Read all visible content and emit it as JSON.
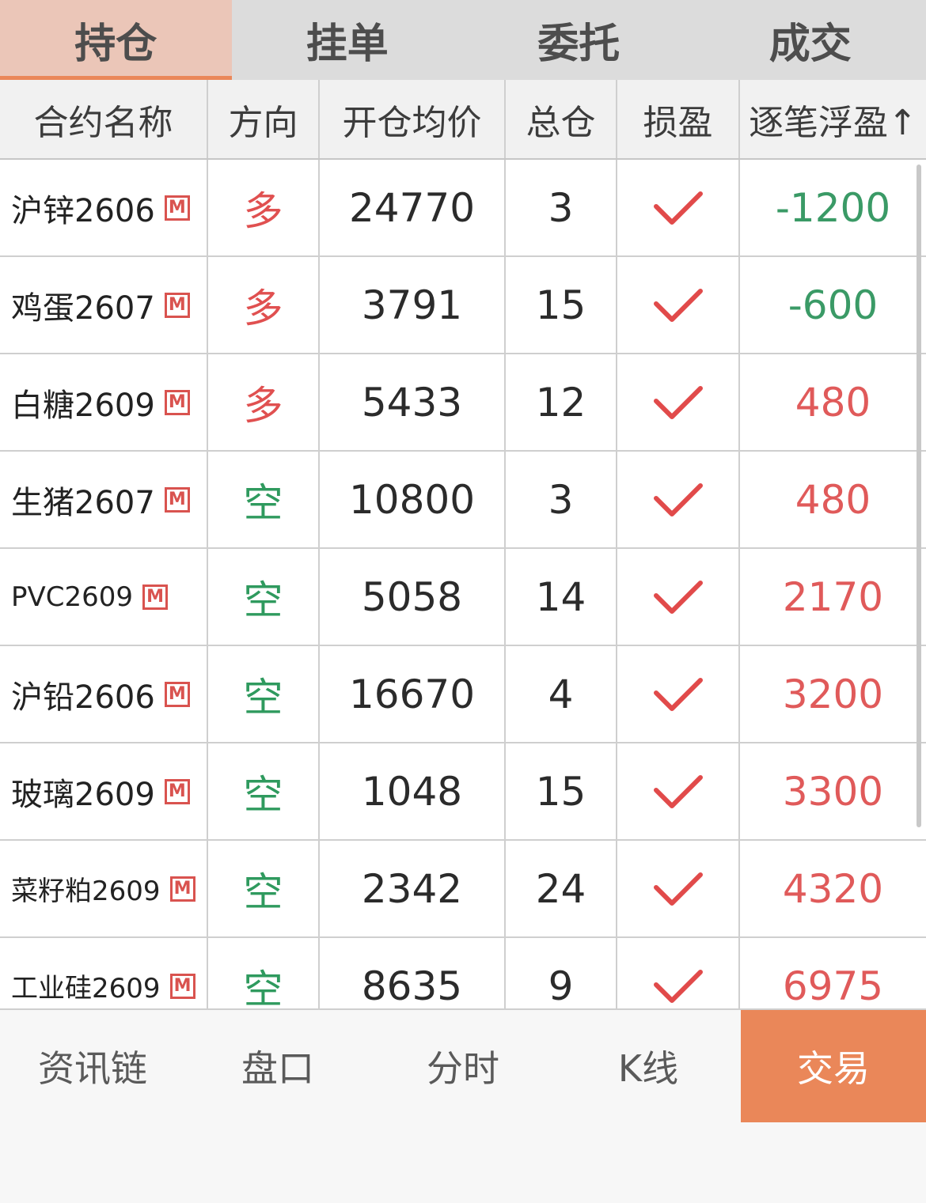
{
  "tabs": [
    {
      "label": "持仓",
      "active": true
    },
    {
      "label": "挂单",
      "active": false
    },
    {
      "label": "委托",
      "active": false
    },
    {
      "label": "成交",
      "active": false
    }
  ],
  "table": {
    "headers": [
      "合约名称",
      "方向",
      "开仓均价",
      "总仓",
      "损盈",
      "逐笔浮盈↑"
    ],
    "rows": [
      {
        "name": "沪锌2606",
        "direction": "多",
        "avg_price": "24770",
        "total": "3",
        "pnl": "-1200"
      },
      {
        "name": "鸡蛋2607",
        "direction": "多",
        "avg_price": "3791",
        "total": "15",
        "pnl": "-600"
      },
      {
        "name": "白糖2609",
        "direction": "多",
        "avg_price": "5433",
        "total": "12",
        "pnl": "480"
      },
      {
        "name": "生猪2607",
        "direction": "空",
        "avg_price": "10800",
        "total": "3",
        "pnl": "480"
      },
      {
        "name": "PVC2609",
        "direction": "空",
        "avg_price": "5058",
        "total": "14",
        "pnl": "2170"
      },
      {
        "name": "沪铅2606",
        "direction": "空",
        "avg_price": "16670",
        "total": "4",
        "pnl": "3200"
      },
      {
        "name": "玻璃2609",
        "direction": "空",
        "avg_price": "1048",
        "total": "15",
        "pnl": "3300"
      },
      {
        "name": "菜籽粕2609",
        "direction": "空",
        "avg_price": "2342",
        "total": "24",
        "pnl": "4320"
      },
      {
        "name": "工业硅2609",
        "direction": "空",
        "avg_price": "8635",
        "total": "9",
        "pnl": "6975"
      }
    ],
    "badge_label": "M",
    "check_icon": "check-icon"
  },
  "bottom_nav": [
    {
      "label": "资讯链",
      "active": false
    },
    {
      "label": "盘口",
      "active": false
    },
    {
      "label": "分时",
      "active": false
    },
    {
      "label": "K线",
      "active": false
    },
    {
      "label": "交易",
      "active": true
    }
  ],
  "colors": {
    "accent": "#ea8759",
    "long": "#e05050",
    "short": "#2f9a5e",
    "profit": "#e05a5a",
    "loss": "#3a9a66"
  }
}
